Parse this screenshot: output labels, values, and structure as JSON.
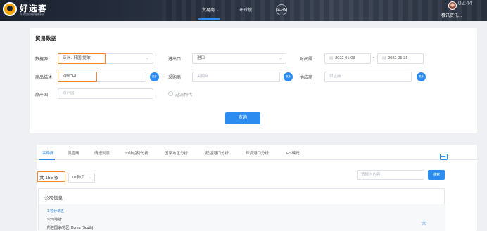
{
  "header": {
    "logo_text": "好选客",
    "logo_sub": "外贸智能获客管理系统",
    "nav": [
      "贸易商",
      "环球搜",
      "SCRM"
    ],
    "time": "02:44",
    "username": "极讯资讯..."
  },
  "form": {
    "title": "贸易数据",
    "data_source": {
      "label": "数据源",
      "value": "亚洲 / 韩国(提单)"
    },
    "direction": {
      "label": "进出口",
      "value": "进口"
    },
    "period": {
      "label": "时间段",
      "start": "2022-01-03",
      "end": "2022-05-31",
      "separator": "-"
    },
    "product": {
      "label": "商品描述",
      "value": "KIMCHI"
    },
    "buyer": {
      "label": "采购商",
      "placeholder": "采购商"
    },
    "supplier": {
      "label": "供应商",
      "placeholder": "供应商"
    },
    "origin": {
      "label": "原产国",
      "placeholder": "原产国"
    },
    "filter_label": "过滤物代",
    "more_label": "更多",
    "query_label": "查询"
  },
  "results": {
    "tabs": [
      "采购商",
      "供应商",
      "情报列表",
      "市场趋势分析",
      "国家地区分析",
      "起运港口分析",
      "卸货港口分析",
      "HS编码"
    ],
    "total": "共 155 条",
    "page_size": "10条/页",
    "search_placeholder": "请输入内容",
    "search_label": "搜索",
    "info_title": "公司信息",
    "rows": [
      "1.暂分辛五",
      "公司地址:",
      "所在国家/地区: Korea (South)"
    ]
  },
  "colors": {
    "accent": "#2d8cf0",
    "highlight": "#f5872a",
    "header_bg": "#1b2230"
  }
}
